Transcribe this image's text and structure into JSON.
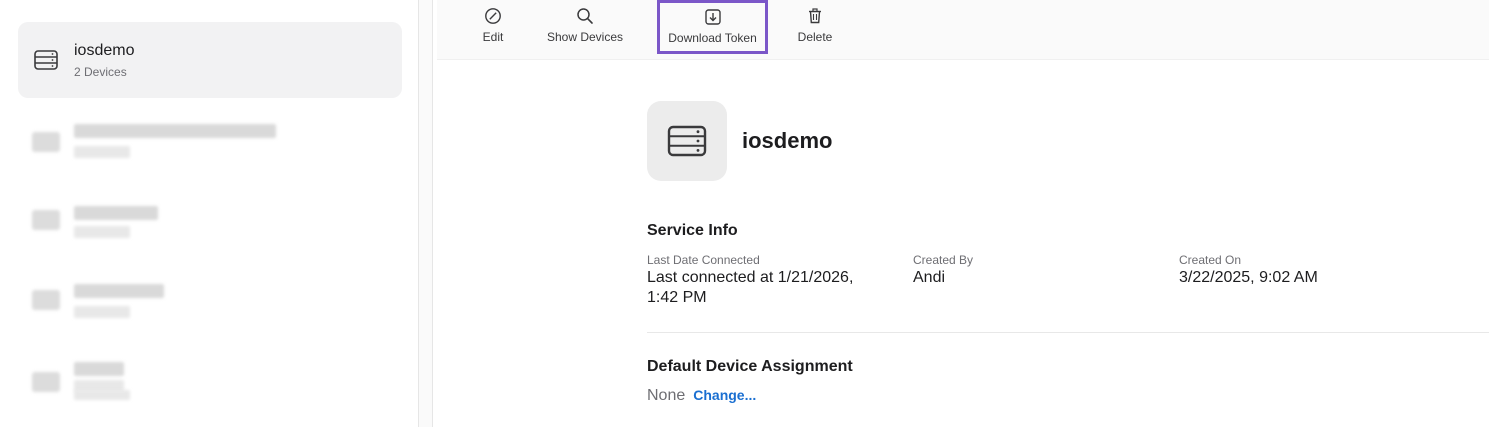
{
  "toolbar": {
    "edit_label": "Edit",
    "show_devices_label": "Show Devices",
    "download_token_label": "Download Token",
    "delete_label": "Delete"
  },
  "sidebar": {
    "items": [
      {
        "name": "iosdemo",
        "subtitle": "2 Devices",
        "selected": true
      }
    ]
  },
  "detail": {
    "title": "iosdemo",
    "service_info": {
      "heading": "Service Info",
      "last_connected_label": "Last Date Connected",
      "last_connected_value": "Last connected at 1/21/2026,",
      "last_connected_value_2": "1:42 PM",
      "created_by_label": "Created By",
      "created_by_value": "Andi",
      "created_on_label": "Created On",
      "created_on_value": "3/22/2025, 9:02 AM"
    },
    "default_assignment": {
      "heading": "Default Device Assignment",
      "value": "None",
      "change_label": "Change..."
    }
  },
  "colors": {
    "highlight_border": "#7b57c8",
    "link": "#1a6fd1",
    "selected_bg": "#f2f2f3"
  }
}
